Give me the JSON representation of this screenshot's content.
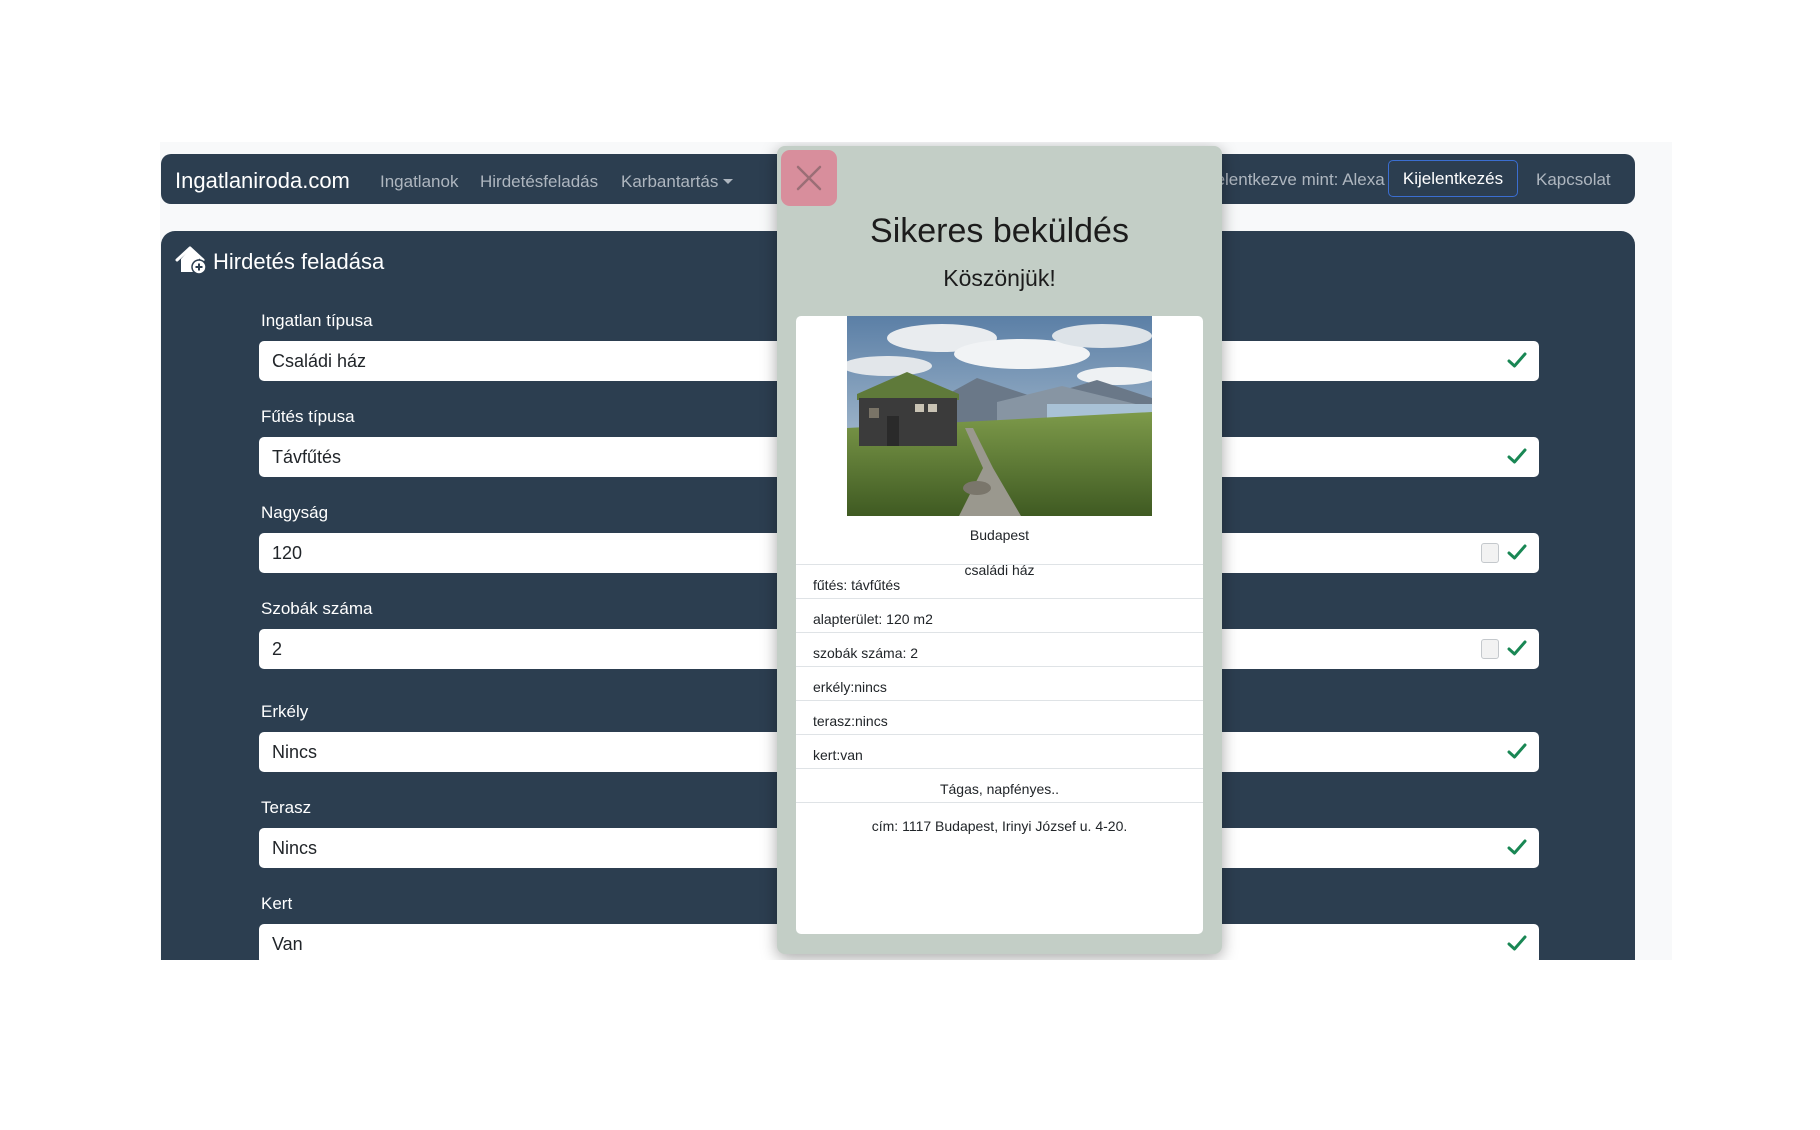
{
  "navbar": {
    "brand": "Ingatlaniroda.com",
    "links": [
      "Ingatlanok",
      "Hirdetésfeladás",
      "Karbantartás"
    ],
    "logged_in_text": "Bejelentkezve mint: Alexa",
    "logout_label": "Kijelentkezés",
    "contact_label": "Kapcsolat"
  },
  "form": {
    "title": "Hirdetés feladása",
    "fields": [
      {
        "label": "Ingatlan típusa",
        "value": "Családi ház"
      },
      {
        "label": "Fűtés típusa",
        "value": "Távfűtés"
      },
      {
        "label": "Nagyság",
        "value": "120"
      },
      {
        "label": "Szobák száma",
        "value": "2"
      },
      {
        "label": "Erkély",
        "value": "Nincs"
      },
      {
        "label": "Terasz",
        "value": "Nincs"
      },
      {
        "label": "Kert",
        "value": "Van"
      }
    ]
  },
  "modal": {
    "title": "Sikeres beküldés",
    "subtitle": "Köszönjük!",
    "card": {
      "city": "Budapest",
      "type": "családi ház",
      "items": [
        "fűtés: távfűtés",
        "alapterület: 120 m2",
        "szobák száma: 2",
        "erkély:nincs",
        "terasz:nincs",
        "kert:van"
      ],
      "description": "Tágas, napfényes..",
      "address": "cím: 1117 Budapest, Irinyi József u. 4-20."
    }
  },
  "colors": {
    "navbar_bg": "#2c3e50",
    "modal_bg": "#c3cec6",
    "close_button": "#d88e9c",
    "check": "#198754"
  }
}
